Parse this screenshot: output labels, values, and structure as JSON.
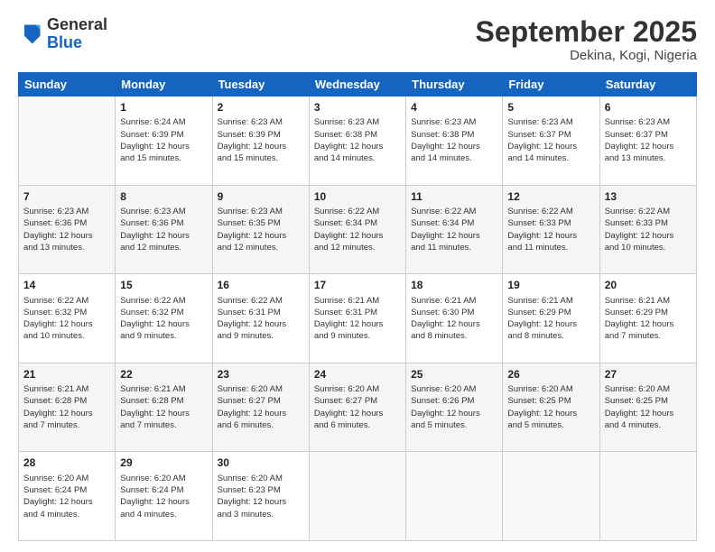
{
  "logo": {
    "general": "General",
    "blue": "Blue"
  },
  "header": {
    "month_year": "September 2025",
    "location": "Dekina, Kogi, Nigeria"
  },
  "days_of_week": [
    "Sunday",
    "Monday",
    "Tuesday",
    "Wednesday",
    "Thursday",
    "Friday",
    "Saturday"
  ],
  "weeks": [
    [
      {
        "num": "",
        "info": ""
      },
      {
        "num": "1",
        "info": "Sunrise: 6:24 AM\nSunset: 6:39 PM\nDaylight: 12 hours\nand 15 minutes."
      },
      {
        "num": "2",
        "info": "Sunrise: 6:23 AM\nSunset: 6:39 PM\nDaylight: 12 hours\nand 15 minutes."
      },
      {
        "num": "3",
        "info": "Sunrise: 6:23 AM\nSunset: 6:38 PM\nDaylight: 12 hours\nand 14 minutes."
      },
      {
        "num": "4",
        "info": "Sunrise: 6:23 AM\nSunset: 6:38 PM\nDaylight: 12 hours\nand 14 minutes."
      },
      {
        "num": "5",
        "info": "Sunrise: 6:23 AM\nSunset: 6:37 PM\nDaylight: 12 hours\nand 14 minutes."
      },
      {
        "num": "6",
        "info": "Sunrise: 6:23 AM\nSunset: 6:37 PM\nDaylight: 12 hours\nand 13 minutes."
      }
    ],
    [
      {
        "num": "7",
        "info": "Sunrise: 6:23 AM\nSunset: 6:36 PM\nDaylight: 12 hours\nand 13 minutes."
      },
      {
        "num": "8",
        "info": "Sunrise: 6:23 AM\nSunset: 6:36 PM\nDaylight: 12 hours\nand 12 minutes."
      },
      {
        "num": "9",
        "info": "Sunrise: 6:23 AM\nSunset: 6:35 PM\nDaylight: 12 hours\nand 12 minutes."
      },
      {
        "num": "10",
        "info": "Sunrise: 6:22 AM\nSunset: 6:34 PM\nDaylight: 12 hours\nand 12 minutes."
      },
      {
        "num": "11",
        "info": "Sunrise: 6:22 AM\nSunset: 6:34 PM\nDaylight: 12 hours\nand 11 minutes."
      },
      {
        "num": "12",
        "info": "Sunrise: 6:22 AM\nSunset: 6:33 PM\nDaylight: 12 hours\nand 11 minutes."
      },
      {
        "num": "13",
        "info": "Sunrise: 6:22 AM\nSunset: 6:33 PM\nDaylight: 12 hours\nand 10 minutes."
      }
    ],
    [
      {
        "num": "14",
        "info": "Sunrise: 6:22 AM\nSunset: 6:32 PM\nDaylight: 12 hours\nand 10 minutes."
      },
      {
        "num": "15",
        "info": "Sunrise: 6:22 AM\nSunset: 6:32 PM\nDaylight: 12 hours\nand 9 minutes."
      },
      {
        "num": "16",
        "info": "Sunrise: 6:22 AM\nSunset: 6:31 PM\nDaylight: 12 hours\nand 9 minutes."
      },
      {
        "num": "17",
        "info": "Sunrise: 6:21 AM\nSunset: 6:31 PM\nDaylight: 12 hours\nand 9 minutes."
      },
      {
        "num": "18",
        "info": "Sunrise: 6:21 AM\nSunset: 6:30 PM\nDaylight: 12 hours\nand 8 minutes."
      },
      {
        "num": "19",
        "info": "Sunrise: 6:21 AM\nSunset: 6:29 PM\nDaylight: 12 hours\nand 8 minutes."
      },
      {
        "num": "20",
        "info": "Sunrise: 6:21 AM\nSunset: 6:29 PM\nDaylight: 12 hours\nand 7 minutes."
      }
    ],
    [
      {
        "num": "21",
        "info": "Sunrise: 6:21 AM\nSunset: 6:28 PM\nDaylight: 12 hours\nand 7 minutes."
      },
      {
        "num": "22",
        "info": "Sunrise: 6:21 AM\nSunset: 6:28 PM\nDaylight: 12 hours\nand 7 minutes."
      },
      {
        "num": "23",
        "info": "Sunrise: 6:20 AM\nSunset: 6:27 PM\nDaylight: 12 hours\nand 6 minutes."
      },
      {
        "num": "24",
        "info": "Sunrise: 6:20 AM\nSunset: 6:27 PM\nDaylight: 12 hours\nand 6 minutes."
      },
      {
        "num": "25",
        "info": "Sunrise: 6:20 AM\nSunset: 6:26 PM\nDaylight: 12 hours\nand 5 minutes."
      },
      {
        "num": "26",
        "info": "Sunrise: 6:20 AM\nSunset: 6:25 PM\nDaylight: 12 hours\nand 5 minutes."
      },
      {
        "num": "27",
        "info": "Sunrise: 6:20 AM\nSunset: 6:25 PM\nDaylight: 12 hours\nand 4 minutes."
      }
    ],
    [
      {
        "num": "28",
        "info": "Sunrise: 6:20 AM\nSunset: 6:24 PM\nDaylight: 12 hours\nand 4 minutes."
      },
      {
        "num": "29",
        "info": "Sunrise: 6:20 AM\nSunset: 6:24 PM\nDaylight: 12 hours\nand 4 minutes."
      },
      {
        "num": "30",
        "info": "Sunrise: 6:20 AM\nSunset: 6:23 PM\nDaylight: 12 hours\nand 3 minutes."
      },
      {
        "num": "",
        "info": ""
      },
      {
        "num": "",
        "info": ""
      },
      {
        "num": "",
        "info": ""
      },
      {
        "num": "",
        "info": ""
      }
    ]
  ]
}
